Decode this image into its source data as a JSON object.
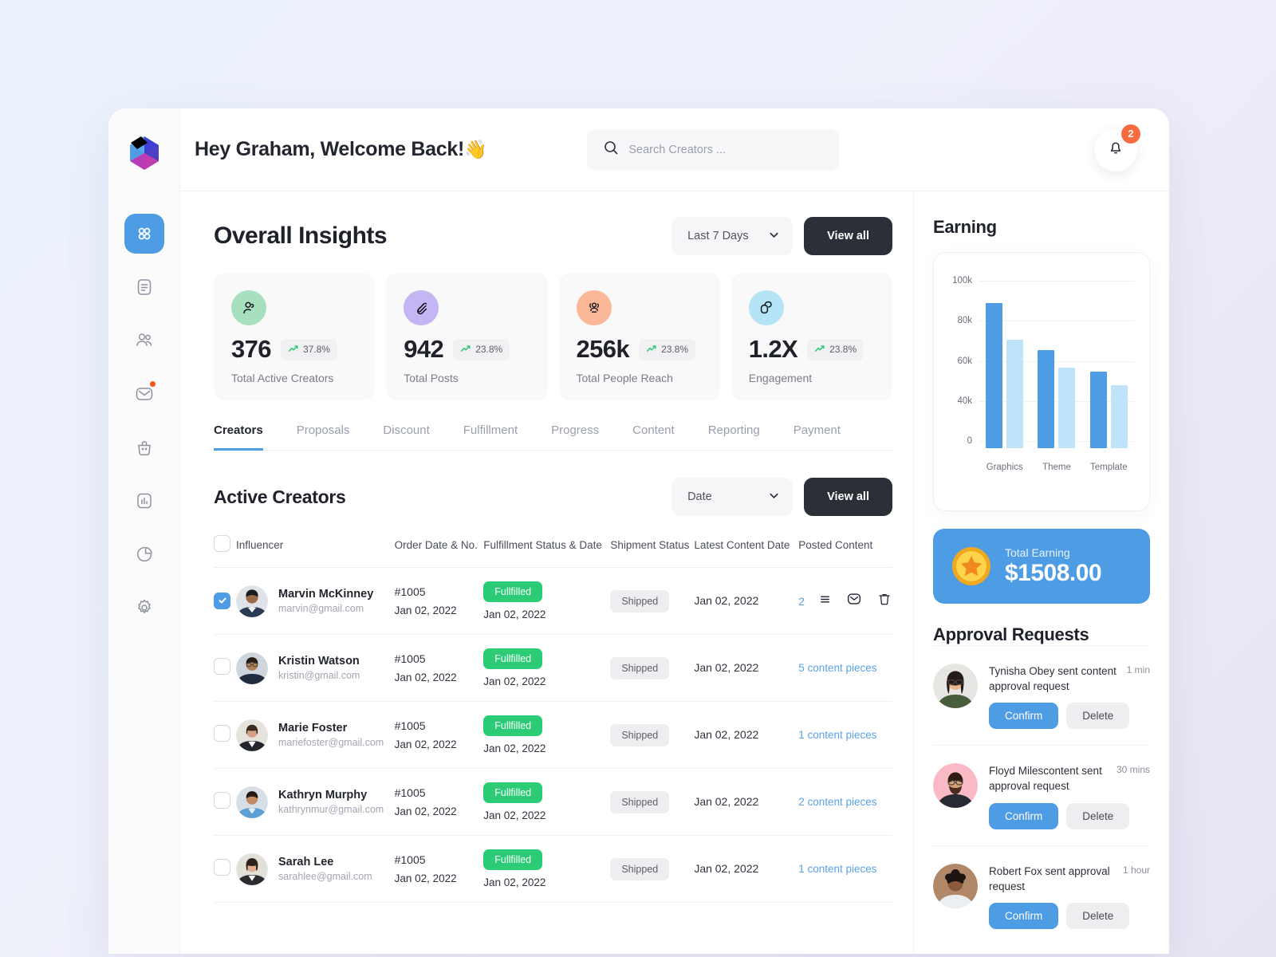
{
  "brand": {
    "logo_name": "logo",
    "accent": "#4e9ce4"
  },
  "sidebar": {
    "items": [
      {
        "label": "Dashboard",
        "icon": "grid-icon",
        "active": true,
        "badge": false
      },
      {
        "label": "Documents",
        "icon": "document-icon",
        "active": false,
        "badge": false
      },
      {
        "label": "Creators",
        "icon": "users-icon",
        "active": false,
        "badge": false
      },
      {
        "label": "Messages",
        "icon": "mail-icon",
        "active": false,
        "badge": true
      },
      {
        "label": "Orders",
        "icon": "bag-icon",
        "active": false,
        "badge": false
      },
      {
        "label": "Analytics",
        "icon": "bar-chart-icon",
        "active": false,
        "badge": false
      },
      {
        "label": "Reports",
        "icon": "pie-chart-icon",
        "active": false,
        "badge": false
      },
      {
        "label": "Settings",
        "icon": "gear-icon",
        "active": false,
        "badge": false
      }
    ]
  },
  "topbar": {
    "greeting": "Hey Graham, Welcome Back!",
    "wave_emoji": "👋",
    "search_placeholder": "Search Creators ...",
    "search_value": "",
    "search_icon": "search-icon",
    "bell_icon": "bell-icon",
    "notification_count": "2"
  },
  "insights": {
    "title": "Overall Insights",
    "range_value": "Last 7 Days",
    "view_all": "View all",
    "cards": [
      {
        "value": "376",
        "delta": "37.8%",
        "label": "Total Active Creators",
        "icon": "user-check-icon",
        "bg": "#a8e0bf"
      },
      {
        "value": "942",
        "delta": "23.8%",
        "label": "Total Posts",
        "icon": "edit-icon",
        "bg": "#c5b5f5"
      },
      {
        "value": "256k",
        "delta": "23.8%",
        "label": "Total People Reach",
        "icon": "people-reach-icon",
        "bg": "#fab898"
      },
      {
        "value": "1.2X",
        "delta": "23.8%",
        "label": "Engagement",
        "icon": "engagement-icon",
        "bg": "#b5e4f7"
      }
    ]
  },
  "tabs": [
    {
      "label": "Creators",
      "active": true
    },
    {
      "label": "Proposals",
      "active": false
    },
    {
      "label": "Discount",
      "active": false
    },
    {
      "label": "Fulfillment",
      "active": false
    },
    {
      "label": "Progress",
      "active": false
    },
    {
      "label": "Content",
      "active": false
    },
    {
      "label": "Reporting",
      "active": false
    },
    {
      "label": "Payment",
      "active": false
    }
  ],
  "table": {
    "title": "Active Creators",
    "sort_value": "Date",
    "view_all": "View all",
    "columns": [
      "Influencer",
      "Order Date & No.",
      "Fulfillment Status & Date",
      "Shipment Status",
      "Latest Content Date",
      "Posted Content"
    ],
    "rows": [
      {
        "selected": true,
        "name": "Marvin McKinney",
        "email": "marvin@gmail.com",
        "order_no": "#1005",
        "order_date": "Jan 02, 2022",
        "fulfillment_status": "Fullfilled",
        "fulfillment_date": "Jan 02, 2022",
        "shipment_status": "Shipped",
        "latest_content_date": "Jan 02, 2022",
        "posted_content": "2",
        "actions": [
          "list-icon",
          "mail-icon",
          "trash-icon"
        ]
      },
      {
        "selected": false,
        "name": "Kristin Watson",
        "email": "kristin@gmail.com",
        "order_no": "#1005",
        "order_date": "Jan 02, 2022",
        "fulfillment_status": "Fullfilled",
        "fulfillment_date": "Jan 02, 2022",
        "shipment_status": "Shipped",
        "latest_content_date": "Jan 02, 2022",
        "posted_content": "5 content pieces",
        "actions": []
      },
      {
        "selected": false,
        "name": "Marie Foster",
        "email": "mariefoster@gmail.com",
        "order_no": "#1005",
        "order_date": "Jan 02, 2022",
        "fulfillment_status": "Fullfilled",
        "fulfillment_date": "Jan 02, 2022",
        "shipment_status": "Shipped",
        "latest_content_date": "Jan 02, 2022",
        "posted_content": "1 content pieces",
        "actions": []
      },
      {
        "selected": false,
        "name": "Kathryn Murphy",
        "email": "kathrynmur@gmail.com",
        "order_no": "#1005",
        "order_date": "Jan 02, 2022",
        "fulfillment_status": "Fullfilled",
        "fulfillment_date": "Jan 02, 2022",
        "shipment_status": "Shipped",
        "latest_content_date": "Jan 02, 2022",
        "posted_content": "2 content pieces",
        "actions": []
      },
      {
        "selected": false,
        "name": "Sarah Lee",
        "email": "sarahlee@gmail.com",
        "order_no": "#1005",
        "order_date": "Jan 02, 2022",
        "fulfillment_status": "Fullfilled",
        "fulfillment_date": "Jan 02, 2022",
        "shipment_status": "Shipped",
        "latest_content_date": "Jan 02, 2022",
        "posted_content": "1 content pieces",
        "actions": []
      }
    ]
  },
  "earning": {
    "title": "Earning",
    "total_label": "Total Earning",
    "total_value": "$1508.00",
    "coin_icon": "coin-star-icon"
  },
  "chart_data": {
    "type": "bar",
    "title": "Earning",
    "categories": [
      "Graphics",
      "Theme",
      "Template"
    ],
    "series": [
      {
        "name": "Primary",
        "color": "#4e9ce4",
        "values": [
          94000,
          63000,
          50000
        ]
      },
      {
        "name": "Secondary",
        "color": "#bfe4fa",
        "values": [
          70000,
          52000,
          41000
        ]
      }
    ],
    "ytick_labels": [
      "100k",
      "80k",
      "60k",
      "40k",
      "0"
    ],
    "ytick_values": [
      100000,
      80000,
      60000,
      40000,
      0
    ],
    "ylim": [
      0,
      108000
    ],
    "xlabel": "",
    "ylabel": "",
    "grid": true,
    "legend": "none"
  },
  "approvals": {
    "title": "Approval Requests",
    "items": [
      {
        "text": "Tynisha Obey sent content approval request",
        "time": "1 min",
        "confirm": "Confirm",
        "delete": "Delete",
        "avatar_bg": "#e4e4e8"
      },
      {
        "text": "Floyd Milescontent sent approval request",
        "time": "30 mins",
        "confirm": "Confirm",
        "delete": "Delete",
        "avatar_bg": "#f9b9c5"
      },
      {
        "text": "Robert Fox  sent approval request",
        "time": "1 hour",
        "confirm": "Confirm",
        "delete": "Delete",
        "avatar_bg": "#c8a98e"
      }
    ]
  }
}
